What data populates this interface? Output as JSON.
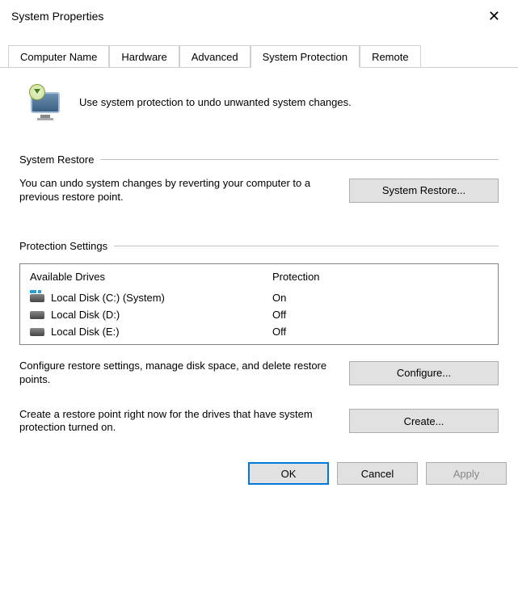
{
  "window": {
    "title": "System Properties"
  },
  "tabs": [
    {
      "label": "Computer Name"
    },
    {
      "label": "Hardware"
    },
    {
      "label": "Advanced"
    },
    {
      "label": "System Protection"
    },
    {
      "label": "Remote"
    }
  ],
  "intro": "Use system protection to undo unwanted system changes.",
  "restore": {
    "group": "System Restore",
    "text": "You can undo system changes by reverting your computer to a previous restore point.",
    "button": "System Restore..."
  },
  "protection": {
    "group": "Protection Settings",
    "headers": {
      "drives": "Available Drives",
      "protection": "Protection"
    },
    "drives": [
      {
        "name": "Local Disk (C:) (System)",
        "status": "On",
        "system": true
      },
      {
        "name": "Local Disk (D:)",
        "status": "Off",
        "system": false
      },
      {
        "name": "Local Disk (E:)",
        "status": "Off",
        "system": false
      }
    ],
    "configure": {
      "text": "Configure restore settings, manage disk space, and delete restore points.",
      "button": "Configure..."
    },
    "create": {
      "text": "Create a restore point right now for the drives that have system protection turned on.",
      "button": "Create..."
    }
  },
  "footer": {
    "ok": "OK",
    "cancel": "Cancel",
    "apply": "Apply"
  }
}
